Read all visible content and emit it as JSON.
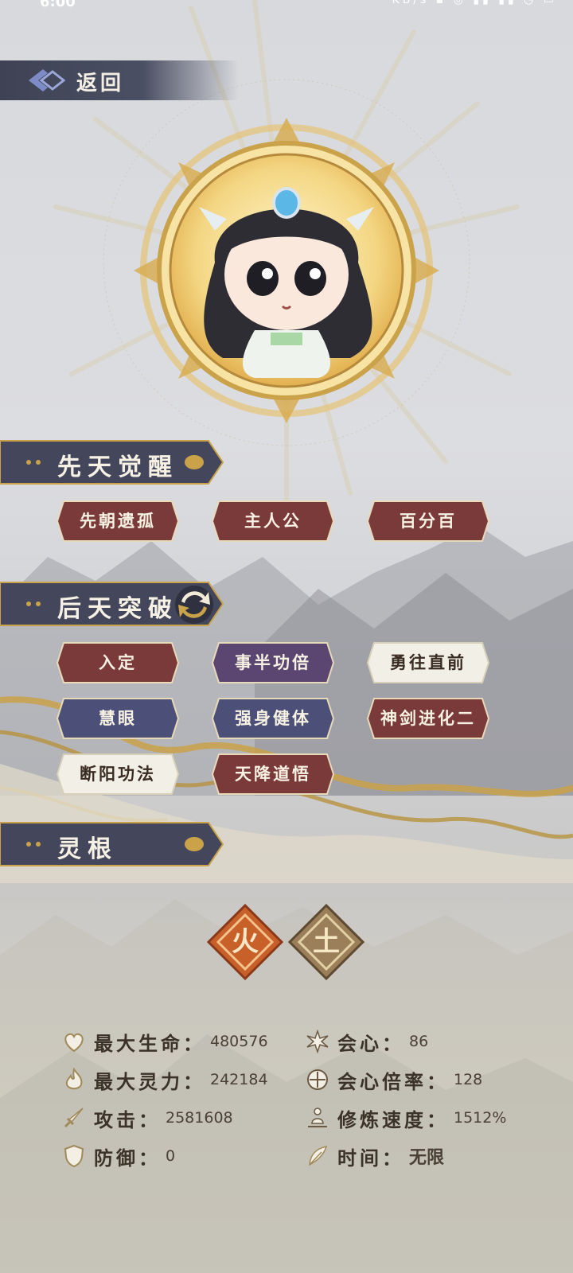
{
  "back": {
    "label": "返回"
  },
  "sections": {
    "innate": "先天觉醒",
    "acquired": "后天突破",
    "spirit_root": "灵根"
  },
  "innate_tags": [
    {
      "label": "先朝遗孤",
      "style": "red"
    },
    {
      "label": "主人公",
      "style": "red"
    },
    {
      "label": "百分百",
      "style": "red"
    }
  ],
  "acquired_tags": [
    {
      "label": "入定",
      "style": "red"
    },
    {
      "label": "事半功倍",
      "style": "purple"
    },
    {
      "label": "勇往直前",
      "style": "light"
    },
    {
      "label": "慧眼",
      "style": "blue"
    },
    {
      "label": "强身健体",
      "style": "blue"
    },
    {
      "label": "神剑进化二",
      "style": "red"
    },
    {
      "label": "断阳功法",
      "style": "light"
    },
    {
      "label": "天降道悟",
      "style": "red"
    }
  ],
  "spirit_roots": [
    {
      "label": "火",
      "color": "#c8602a"
    },
    {
      "label": "土",
      "color": "#9a7f5a"
    }
  ],
  "stats": {
    "max_hp": {
      "label": "最大生命：",
      "value": "480576",
      "icon": "heart-icon"
    },
    "crit": {
      "label": "会心：",
      "value": "86",
      "icon": "burst-icon"
    },
    "max_mp": {
      "label": "最大灵力：",
      "value": "242184",
      "icon": "flame-icon"
    },
    "crit_rate": {
      "label": "会心倍率：",
      "value": "128",
      "icon": "target-icon"
    },
    "attack": {
      "label": "攻击：",
      "value": "2581608",
      "icon": "sword-icon"
    },
    "cultivation_speed": {
      "label": "修炼速度：",
      "value": "1512%",
      "icon": "meditation-icon"
    },
    "defense": {
      "label": "防御：",
      "value": "0",
      "icon": "shield-icon"
    },
    "time": {
      "label": "时间：",
      "value": "无限",
      "icon": "feather-icon"
    }
  },
  "colors": {
    "banner": "#44475b",
    "tag_red": "#7a3a3a",
    "tag_purple": "#5a4670",
    "tag_blue": "#4c5078",
    "tag_light": "#f1efe6",
    "gold": "#c9a24a"
  }
}
